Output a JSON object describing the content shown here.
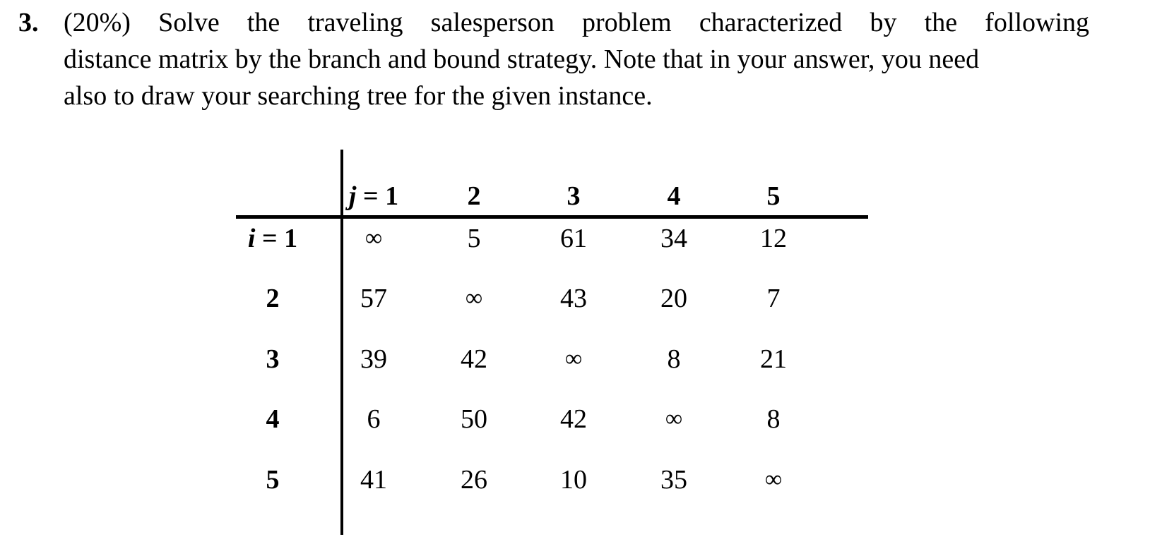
{
  "question": {
    "number": "3.",
    "lines": [
      "(20%) Solve the traveling salesperson problem characterized by the following",
      "distance matrix by the branch and bound strategy. Note that in your answer, you need",
      "also to draw your searching tree for the given instance."
    ]
  },
  "matrix": {
    "row_var": "i",
    "col_var": "j",
    "equals": " = ",
    "col_headers": [
      "1",
      "2",
      "3",
      "4",
      "5"
    ],
    "row_headers": [
      "1",
      "2",
      "3",
      "4",
      "5"
    ],
    "values": [
      [
        "∞",
        "5",
        "61",
        "34",
        "12"
      ],
      [
        "57",
        "∞",
        "43",
        "20",
        "7"
      ],
      [
        "39",
        "42",
        "∞",
        "8",
        "21"
      ],
      [
        "6",
        "50",
        "42",
        "∞",
        "8"
      ],
      [
        "41",
        "26",
        "10",
        "35",
        "∞"
      ]
    ]
  }
}
